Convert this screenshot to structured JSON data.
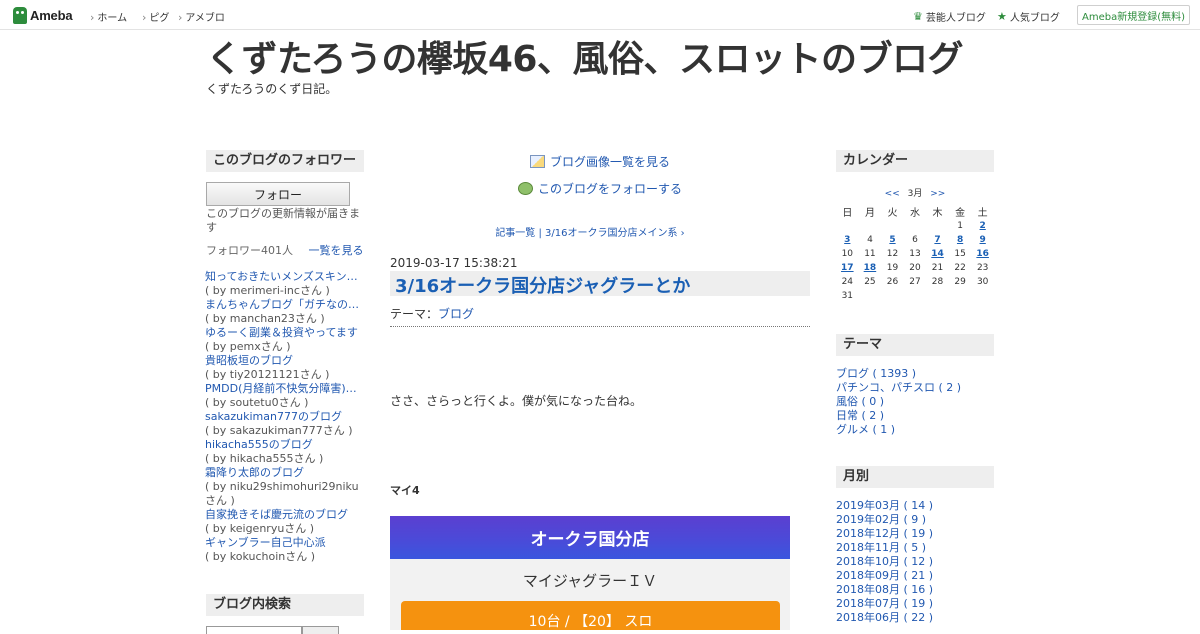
{
  "topbar": {
    "logo_text": "Ameba",
    "nav": [
      "ホーム",
      "ピグ",
      "アメブロ"
    ],
    "right_links": [
      "芸能人ブログ",
      "人気ブログ"
    ],
    "signup": "Ameba新規登録(無料)"
  },
  "header": {
    "title": "くずたろうの欅坂46、風俗、スロットのブログ",
    "description": "くずたろうのくず日記。"
  },
  "left": {
    "followers_head": "このブログのフォロワー",
    "follow_button": "フォロー",
    "follow_note": "このブログの更新情報が届きます",
    "follower_count": "フォロワー401人",
    "see_all": "一覧を見る",
    "followers": [
      {
        "blog": "知っておきたいメンズスキンケア",
        "by": "( by merimeri-incさん )"
      },
      {
        "blog": "まんちゃんブログ「ガチなの？」",
        "by": "( by manchan23さん )"
      },
      {
        "blog": "ゆるーく副業＆投資やってます",
        "by": "( by pemxさん )"
      },
      {
        "blog": "貴昭板垣のブログ",
        "by": "( by tiy20121121さん )"
      },
      {
        "blog": "PMDD(月経前不快気分障害)と…",
        "by": "( by soutetu0さん )"
      },
      {
        "blog": "sakazukiman777のブログ",
        "by": "( by sakazukiman777さん )"
      },
      {
        "blog": "hikacha555のブログ",
        "by": "( by hikacha555さん )"
      },
      {
        "blog": "霜降り太郎のブログ",
        "by": "( by niku29shimohuri29nikuさん )"
      },
      {
        "blog": "自家挽きそば慶元流のブログ",
        "by": "( by keigenryuさん )"
      },
      {
        "blog": "ギャンブラー自己中心派",
        "by": "( by kokuchoinさん )"
      }
    ],
    "search_head": "ブログ内検索"
  },
  "center": {
    "image_list_link": "ブログ画像一覧を見る",
    "follow_link": "このブログをフォローする",
    "entry_nav": "記事一覧 | 3/16オークラ国分店メイン系 ›",
    "date": "2019-03-17 15:38:21",
    "title": "3/16オークラ国分店ジャグラーとか",
    "theme_label": "テーマ：",
    "theme_value": "ブログ",
    "body": "ささ、さらっと行くよ。僕が気になった台ね。",
    "subheading": "マイ4",
    "card": {
      "store": "オークラ国分店",
      "machine": "マイジャグラーＩＶ",
      "rate": "10台 / 【20】 スロ"
    }
  },
  "right": {
    "calendar_head": "カレンダー",
    "cal_prev": "<<",
    "cal_month": "3月",
    "cal_next": ">>",
    "weekdays": [
      "日",
      "月",
      "火",
      "水",
      "木",
      "金",
      "土"
    ],
    "weeks": [
      [
        "",
        "",
        "",
        "",
        "",
        "1",
        "2"
      ],
      [
        "3",
        "4",
        "5",
        "6",
        "7",
        "8",
        "9"
      ],
      [
        "10",
        "11",
        "12",
        "13",
        "14",
        "15",
        "16"
      ],
      [
        "17",
        "18",
        "19",
        "20",
        "21",
        "22",
        "23"
      ],
      [
        "24",
        "25",
        "26",
        "27",
        "28",
        "29",
        "30"
      ],
      [
        "31",
        "",
        "",
        "",
        "",
        "",
        ""
      ]
    ],
    "linked_days": [
      "2",
      "3",
      "5",
      "7",
      "8",
      "9",
      "14",
      "16",
      "17",
      "18"
    ],
    "theme_head": "テーマ",
    "themes": [
      "ブログ ( 1393 )",
      "パチンコ、パチスロ ( 2 )",
      "風俗 ( 0 )",
      "日常 ( 2 )",
      "グルメ ( 1 )"
    ],
    "monthly_head": "月別",
    "months": [
      "2019年03月 ( 14 )",
      "2019年02月 ( 9 )",
      "2018年12月 ( 19 )",
      "2018年11月 ( 5 )",
      "2018年10月 ( 12 )",
      "2018年09月 ( 21 )",
      "2018年08月 ( 16 )",
      "2018年07月 ( 19 )",
      "2018年06月 ( 22 )"
    ]
  }
}
